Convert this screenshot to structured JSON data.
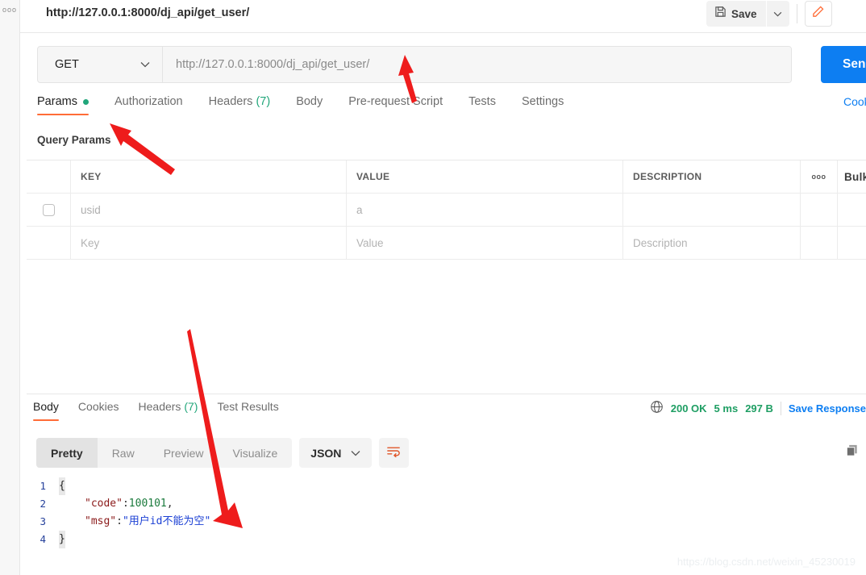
{
  "window": {
    "request_title": "http://127.0.0.1:8000/dj_api/get_user/",
    "rail_more": "ooo"
  },
  "toolbar": {
    "save_label": "Save",
    "save_icon": "floppy-disk-icon",
    "save_caret_icon": "chevron-down-icon",
    "edit_icon": "pencil-icon"
  },
  "url_bar": {
    "method": "GET",
    "method_caret_icon": "chevron-down-icon",
    "url_value": "http://127.0.0.1:8000/dj_api/get_user/",
    "send_label": "Send"
  },
  "request_tabs": {
    "items": [
      {
        "label": "Params",
        "badge": "",
        "dot": true,
        "active": true
      },
      {
        "label": "Authorization",
        "badge": "",
        "dot": false,
        "active": false
      },
      {
        "label": "Headers",
        "badge": "(7)",
        "dot": false,
        "active": false
      },
      {
        "label": "Body",
        "badge": "",
        "dot": false,
        "active": false
      },
      {
        "label": "Pre-request Script",
        "badge": "",
        "dot": false,
        "active": false
      },
      {
        "label": "Tests",
        "badge": "",
        "dot": false,
        "active": false
      },
      {
        "label": "Settings",
        "badge": "",
        "dot": false,
        "active": false
      }
    ],
    "cookies_link": "Cookies"
  },
  "query_params": {
    "heading": "Query Params",
    "columns": [
      "KEY",
      "VALUE",
      "DESCRIPTION"
    ],
    "options_icon": "ellipsis-icon",
    "bulk_edit_label": "Bulk Edit",
    "rows": [
      {
        "checked": false,
        "key": "usid",
        "value": "a",
        "description": "",
        "is_placeholder": false
      },
      {
        "checked": null,
        "key": "Key",
        "value": "Value",
        "description": "Description",
        "is_placeholder": true
      }
    ]
  },
  "response": {
    "tabs": [
      {
        "label": "Body",
        "badge": "",
        "active": true
      },
      {
        "label": "Cookies",
        "badge": "",
        "active": false
      },
      {
        "label": "Headers",
        "badge": "(7)",
        "active": false
      },
      {
        "label": "Test Results",
        "badge": "",
        "active": false
      }
    ],
    "globe_icon": "globe-icon",
    "status": "200 OK",
    "time": "5 ms",
    "size": "297 B",
    "save_response_label": "Save Response",
    "view_modes": [
      "Pretty",
      "Raw",
      "Preview",
      "Visualize"
    ],
    "active_view_mode": "Pretty",
    "format": "JSON",
    "format_caret_icon": "chevron-down-icon",
    "wrap_icon": "wrap-lines-icon",
    "copy_icon": "copy-icon",
    "body_lines": [
      {
        "num": "1",
        "tokens": [
          {
            "t": "{",
            "c": "brace"
          }
        ]
      },
      {
        "num": "2",
        "tokens": [
          {
            "t": "    ",
            "c": "indent"
          },
          {
            "t": "\"code\"",
            "c": "k-str"
          },
          {
            "t": ": ",
            "c": "punct"
          },
          {
            "t": "100101",
            "c": "k-num"
          },
          {
            "t": ",",
            "c": "punct"
          }
        ]
      },
      {
        "num": "3",
        "tokens": [
          {
            "t": "    ",
            "c": "indent"
          },
          {
            "t": "\"msg\"",
            "c": "k-str"
          },
          {
            "t": ": ",
            "c": "punct"
          },
          {
            "t": "\"用户id不能为空\"",
            "c": "k-val"
          }
        ]
      },
      {
        "num": "4",
        "tokens": [
          {
            "t": "}",
            "c": "brace"
          }
        ]
      }
    ]
  },
  "watermark": "https://blog.csdn.net/weixin_45230019",
  "annotations": {
    "arrow_color": "#ee1c1c",
    "arrows": [
      {
        "name": "arrow-to-url-input"
      },
      {
        "name": "arrow-to-params-tab"
      },
      {
        "name": "arrow-to-response-message"
      }
    ]
  },
  "colors": {
    "accent_orange": "#ff6c37",
    "send_blue": "#0d7ef2",
    "status_green": "#1e9e63",
    "link_blue": "#0d7ef2"
  }
}
